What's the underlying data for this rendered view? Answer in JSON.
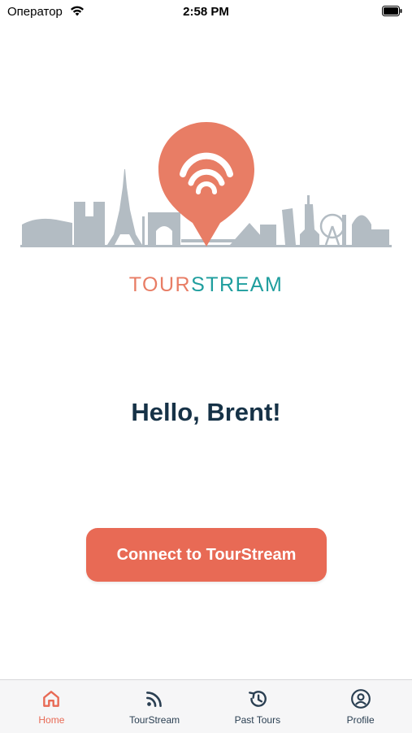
{
  "status_bar": {
    "carrier": "Оператор",
    "time": "2:58 PM"
  },
  "brand": {
    "part1": "TOUR",
    "part2": "STREAM",
    "color_tour": "#e87d65",
    "color_stream": "#1f9e9e"
  },
  "main": {
    "greeting": "Hello, Brent!",
    "connect_label": "Connect to TourStream"
  },
  "tab_bar": {
    "tabs": [
      {
        "label": "Home",
        "icon": "home-icon",
        "active": true
      },
      {
        "label": "TourStream",
        "icon": "rss-icon",
        "active": false
      },
      {
        "label": "Past Tours",
        "icon": "history-icon",
        "active": false
      },
      {
        "label": "Profile",
        "icon": "profile-icon",
        "active": false
      }
    ]
  },
  "colors": {
    "accent": "#e86a55",
    "heading": "#163247",
    "skyline": "#b3bcc3"
  }
}
